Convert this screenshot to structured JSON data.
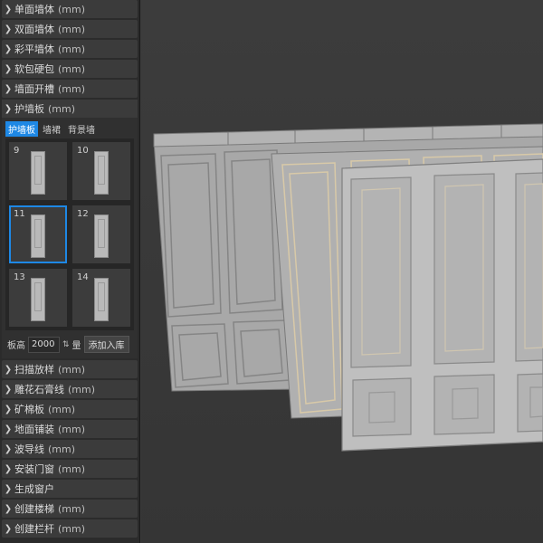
{
  "sidebar": {
    "top_sections": [
      {
        "label": "单面墙体",
        "unit": "(mm)"
      },
      {
        "label": "双面墙体",
        "unit": "(mm)"
      },
      {
        "label": "彩平墙体",
        "unit": "(mm)"
      },
      {
        "label": "软包硬包",
        "unit": "(mm)"
      },
      {
        "label": "墙面开槽",
        "unit": "(mm)"
      }
    ],
    "expanded": {
      "label": "护墙板",
      "unit": "(mm)",
      "tabs": [
        "护墙板",
        "墙裙",
        "背景墙"
      ],
      "items": [
        {
          "num": "9"
        },
        {
          "num": "10"
        },
        {
          "num": "11"
        },
        {
          "num": "12"
        },
        {
          "num": "13"
        },
        {
          "num": "14"
        }
      ],
      "height_label": "板高",
      "height_value": "2000",
      "qty_label": "量",
      "add_button": "添加入库"
    },
    "bottom_sections": [
      {
        "label": "扫描放样",
        "unit": "(mm)"
      },
      {
        "label": "雕花石膏线",
        "unit": "(mm)"
      },
      {
        "label": "矿棉板",
        "unit": "(mm)"
      },
      {
        "label": "地面铺装",
        "unit": "(mm)"
      },
      {
        "label": "波导线",
        "unit": "(mm)"
      },
      {
        "label": "安装门窗",
        "unit": "(mm)"
      },
      {
        "label": "生成窗户",
        "unit": ""
      },
      {
        "label": "创建楼梯",
        "unit": "(mm)"
      },
      {
        "label": "创建栏杆",
        "unit": "(mm)"
      }
    ]
  }
}
